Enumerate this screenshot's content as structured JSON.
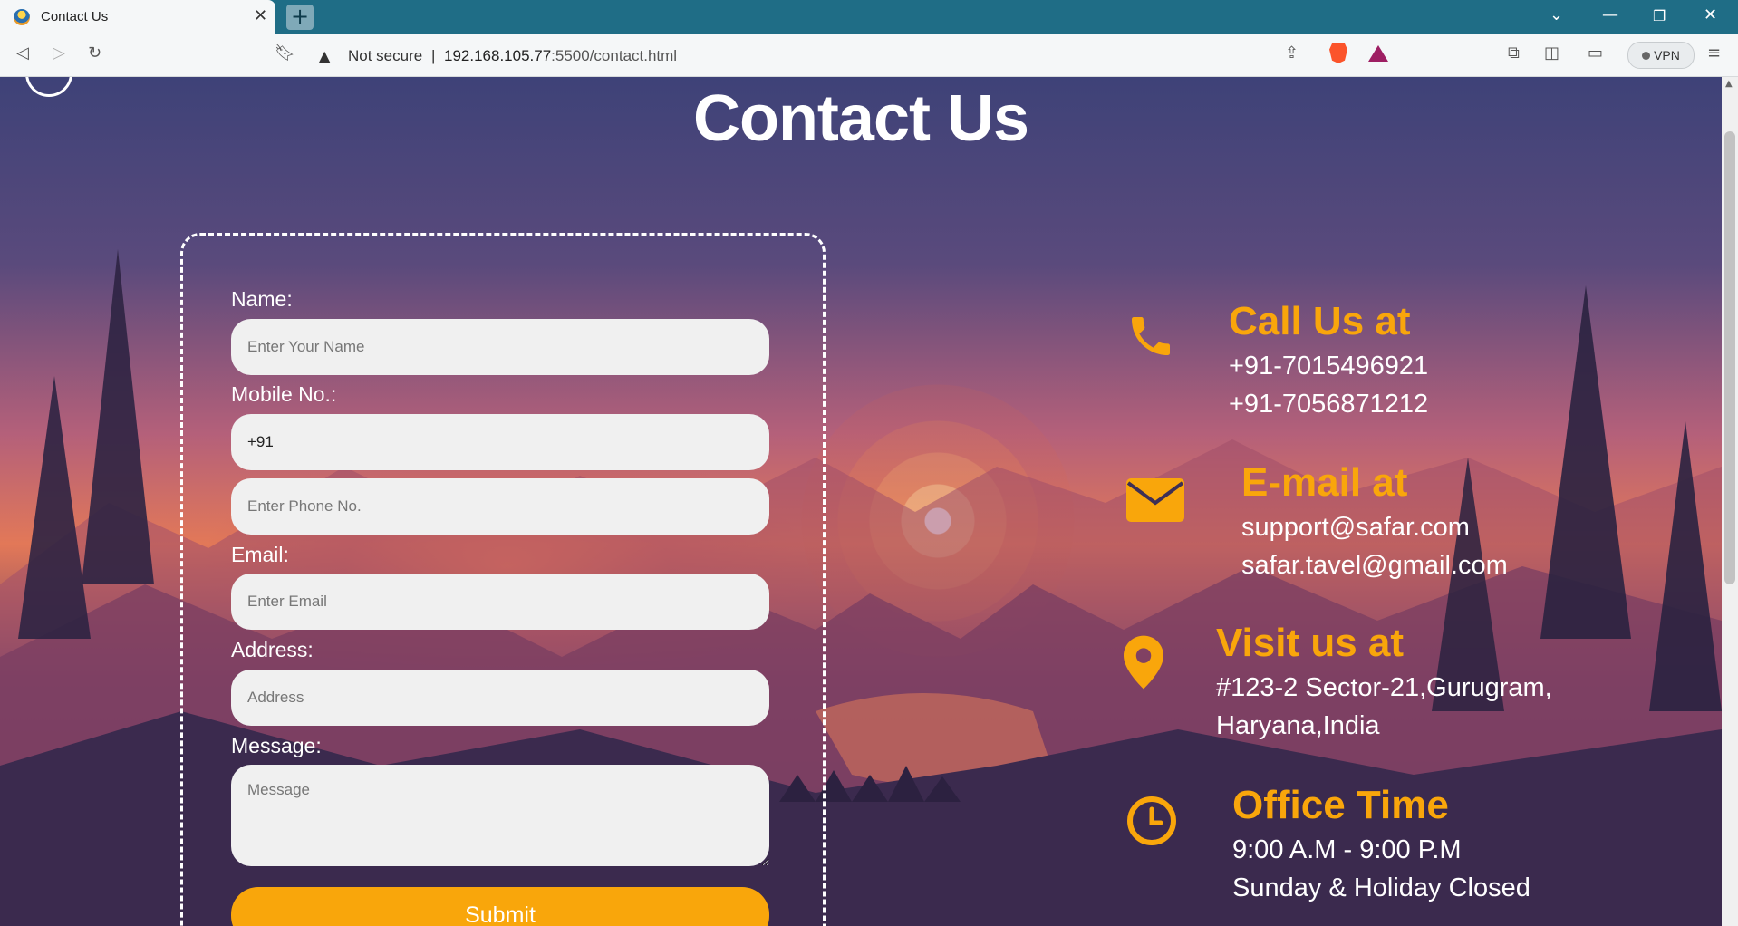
{
  "browser": {
    "tab_title": "Contact Us",
    "new_tab_label": "+",
    "address_warning": "Not secure",
    "url_host": "192.168.105.77",
    "url_rest": ":5500/contact.html",
    "vpn_label": "VPN"
  },
  "page": {
    "title": "Contact Us"
  },
  "form": {
    "name_label": "Name:",
    "name_placeholder": "Enter Your Name",
    "mobile_label": "Mobile No.:",
    "country_code_value": "+91",
    "phone_placeholder": "Enter Phone No.",
    "email_label": "Email:",
    "email_placeholder": "Enter Email",
    "address_label": "Address:",
    "address_placeholder": "Address",
    "message_label": "Message:",
    "message_placeholder": "Message",
    "submit_label": "Submit"
  },
  "contact": {
    "call": {
      "heading": "Call Us at",
      "lines": [
        "+91-7015496921",
        "+91-7056871212"
      ]
    },
    "email": {
      "heading": "E-mail at",
      "lines": [
        "support@safar.com",
        "safar.tavel@gmail.com"
      ]
    },
    "visit": {
      "heading": "Visit us at",
      "lines": [
        "#123-2 Sector-21,Gurugram,",
        "Haryana,India"
      ]
    },
    "office": {
      "heading": "Office Time",
      "lines": [
        "9:00 A.M - 9:00 P.M",
        "Sunday & Holiday Closed"
      ]
    }
  },
  "colors": {
    "accent": "#f9a60b",
    "tabbar": "#1f6d86",
    "input_bg": "#f0f0f0"
  }
}
